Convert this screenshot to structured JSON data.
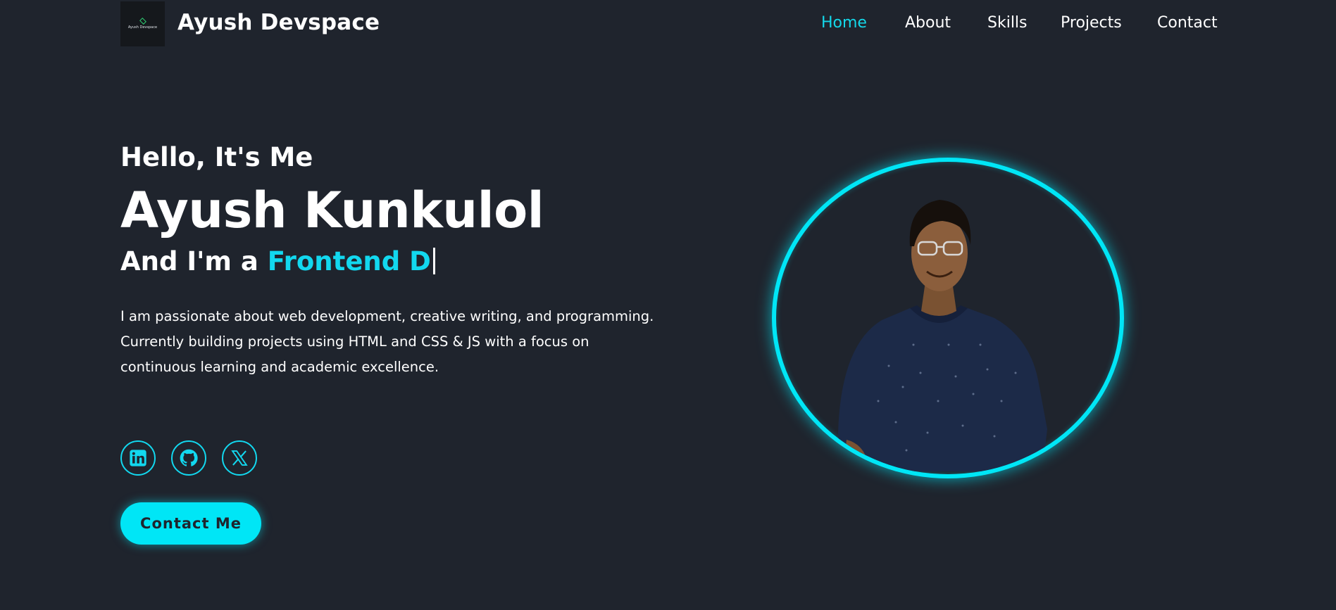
{
  "header": {
    "logo_text": "Ayush Devspace",
    "brand": "Ayush Devspace",
    "nav": [
      {
        "label": "Home",
        "active": true
      },
      {
        "label": "About",
        "active": false
      },
      {
        "label": "Skills",
        "active": false
      },
      {
        "label": "Projects",
        "active": false
      },
      {
        "label": "Contact",
        "active": false
      }
    ]
  },
  "hero": {
    "greeting": "Hello, It's Me",
    "name": "Ayush Kunkulol",
    "role_prefix": "And I'm a",
    "role_typed": "Frontend D",
    "description": "I am passionate about web development, creative writing, and programming. Currently building projects using HTML and CSS & JS with a focus on continuous learning and academic excellence.",
    "socials": [
      {
        "name": "linkedin",
        "icon": "linkedin-icon"
      },
      {
        "name": "github",
        "icon": "github-icon"
      },
      {
        "name": "x",
        "icon": "x-icon"
      }
    ],
    "contact_button": "Contact Me"
  },
  "colors": {
    "background": "#1f242d",
    "accent": "#00e6f6",
    "text": "#ffffff"
  }
}
